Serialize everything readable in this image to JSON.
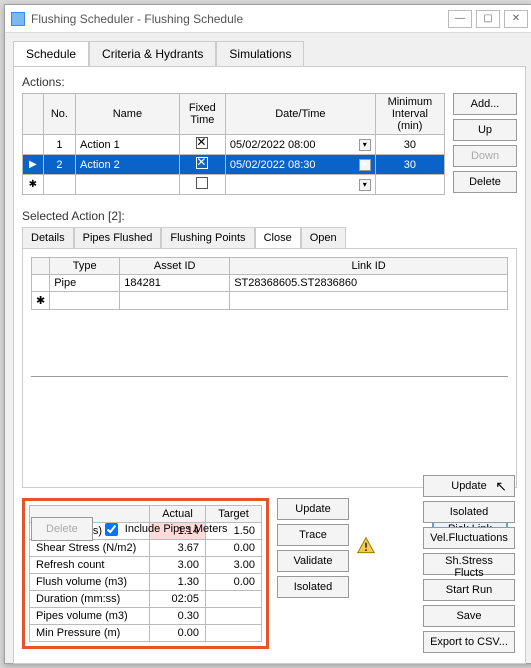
{
  "window": {
    "title": "Flushing Scheduler - Flushing Schedule"
  },
  "tabs": {
    "schedule": "Schedule",
    "criteria": "Criteria & Hydrants",
    "simulations": "Simulations"
  },
  "actions": {
    "label": "Actions:",
    "cols": {
      "no": "No.",
      "name": "Name",
      "fixed": "Fixed\nTime",
      "date": "Date/Time",
      "min": "Minimum\nInterval\n(min)"
    },
    "rows": [
      {
        "no": "1",
        "name": "Action 1",
        "date": "05/02/2022 08:00",
        "min": "30"
      },
      {
        "no": "2",
        "name": "Action 2",
        "date": "05/02/2022 08:30",
        "min": "30"
      }
    ],
    "buttons": {
      "add": "Add...",
      "up": "Up",
      "down": "Down",
      "delete": "Delete"
    }
  },
  "selected": {
    "label": "Selected Action [2]:",
    "tabs": {
      "details": "Details",
      "pipes": "Pipes Flushed",
      "points": "Flushing Points",
      "close": "Close",
      "open": "Open"
    },
    "close_grid": {
      "cols": {
        "type": "Type",
        "asset": "Asset ID",
        "link": "Link ID"
      },
      "rows": [
        {
          "type": "Pipe",
          "asset": "184281",
          "link": "ST28368605.ST2836860"
        }
      ]
    },
    "delete": "Delete",
    "include": "Include Pipes  Meters",
    "pick": "Pick Link"
  },
  "stats": {
    "cols": {
      "actual": "Actual",
      "target": "Target"
    },
    "rows": [
      {
        "label": "Velocity (m/s)",
        "actual": "1.14",
        "target": "1.50",
        "red": true
      },
      {
        "label": "Shear Stress (N/m2)",
        "actual": "3.67",
        "target": "0.00"
      },
      {
        "label": "Refresh count",
        "actual": "3.00",
        "target": "3.00"
      },
      {
        "label": "Flush volume (m3)",
        "actual": "1.30",
        "target": "0.00"
      },
      {
        "label": "Duration (mm:ss)",
        "actual": "02:05",
        "target": ""
      },
      {
        "label": "Pipes volume (m3)",
        "actual": "0.30",
        "target": ""
      },
      {
        "label": "Min Pressure (m)",
        "actual": "0.00",
        "target": ""
      }
    ],
    "mini": {
      "update": "Update",
      "trace": "Trace",
      "validate": "Validate",
      "isolated": "Isolated"
    }
  },
  "right": {
    "update": "Update",
    "isolated": "Isolated",
    "vel": "Vel.Fluctuations",
    "shs": "Sh.Stress Flucts",
    "start": "Start Run",
    "save": "Save",
    "export": "Export to CSV..."
  }
}
